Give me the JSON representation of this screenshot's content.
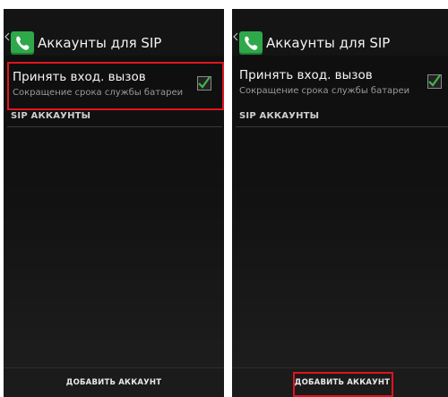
{
  "screens": [
    {
      "title": "Аккаунты для SIP",
      "pref_title": "Принять вход. вызов",
      "pref_summary": "Сокращение срока службы батареи",
      "pref_checked": true,
      "section_header": "SIP АККАУНТЫ",
      "add_button_label": "ДОБАВИТЬ АККАУНТ",
      "highlighted": "pref-row"
    },
    {
      "title": "Аккаунты для SIP",
      "pref_title": "Принять вход. вызов",
      "pref_summary": "Сокращение срока службы батареи",
      "pref_checked": true,
      "section_header": "SIP АККАУНТЫ",
      "add_button_label": "ДОБАВИТЬ АККАУНТ",
      "highlighted": "add-account-button"
    }
  ],
  "colors": {
    "highlight": "#e0141e",
    "check": "#45b34a",
    "app_icon": "#2fa84a"
  },
  "icons": {
    "up": "chevron-left-icon",
    "app": "phone-icon",
    "check": "checkmark-icon"
  }
}
